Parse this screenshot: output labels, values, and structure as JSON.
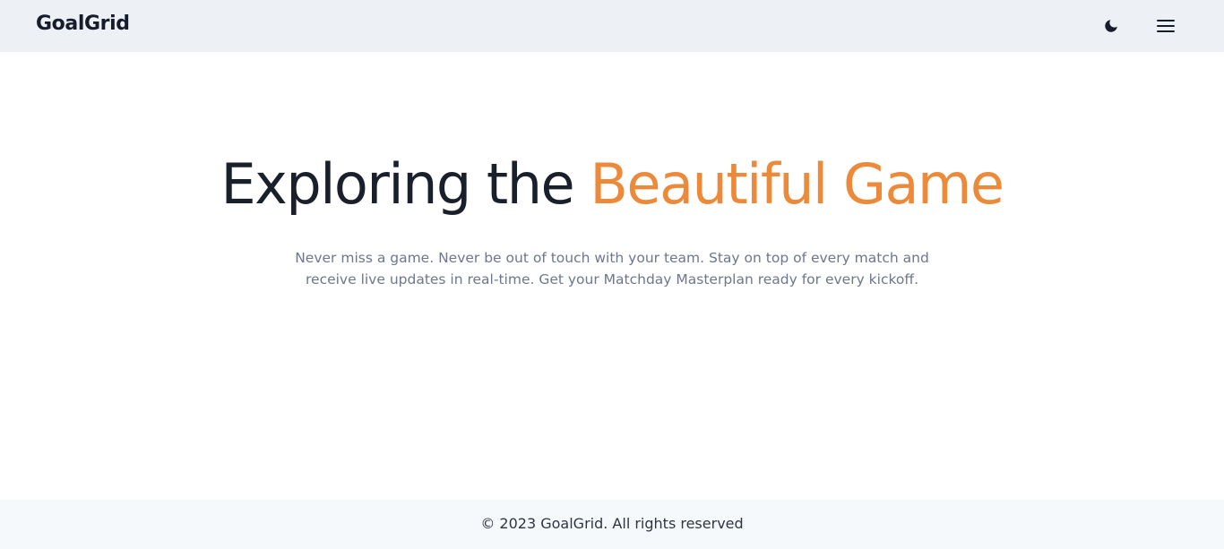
{
  "header": {
    "logo": "GoalGrid",
    "theme_toggle_icon": "moon-icon",
    "menu_icon": "hamburger-menu-icon"
  },
  "hero": {
    "title_main": "Exploring the",
    "title_accent": "Beautiful Game",
    "subtitle": "Never miss a game. Never be out of touch with your team. Stay on top of every match and receive live updates in real-time. Get your Matchday Masterplan ready for every kickoff."
  },
  "footer": {
    "copyright": "© 2023 GoalGrid. All rights reserved"
  },
  "colors": {
    "accent": "#ec8a3a",
    "header_bg": "#edf1f6",
    "footer_bg": "#f6f9fc",
    "text_dark": "#1a1f2c",
    "text_muted": "#6f768d"
  }
}
